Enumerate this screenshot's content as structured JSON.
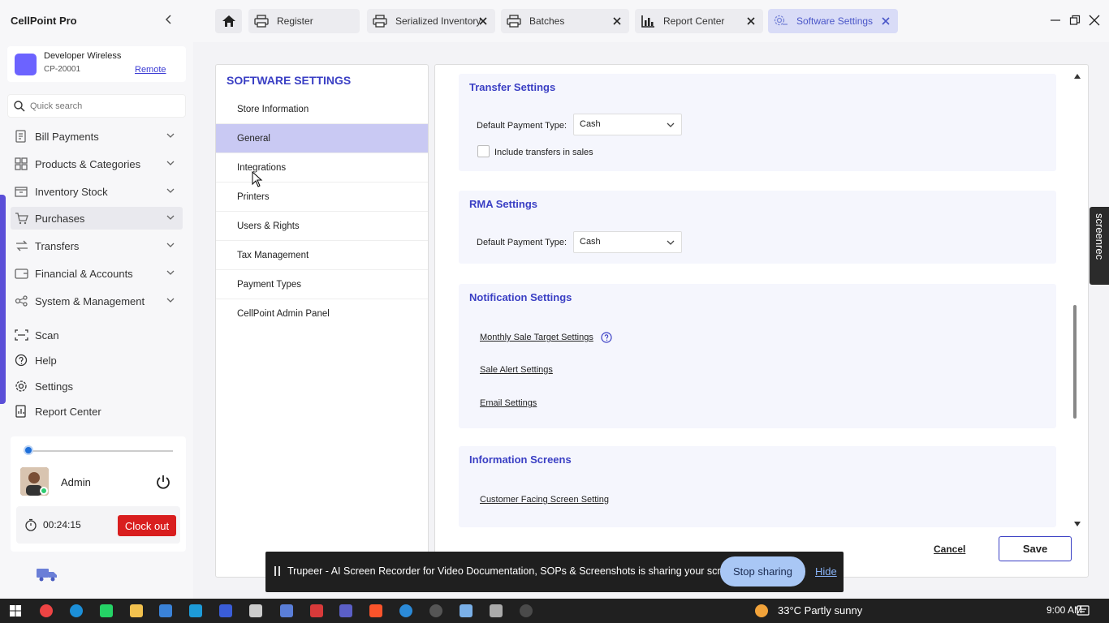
{
  "app": {
    "title": "CellPoint Pro"
  },
  "store": {
    "name": "Developer Wireless",
    "code": "CP-20001",
    "remote_label": "Remote"
  },
  "search": {
    "placeholder": "Quick search"
  },
  "sidebar": {
    "items": [
      {
        "label": "Bill Payments",
        "icon": "receipt-icon",
        "expandable": true
      },
      {
        "label": "Products & Categories",
        "icon": "grid-icon",
        "expandable": true
      },
      {
        "label": "Inventory Stock",
        "icon": "box-icon",
        "expandable": true
      },
      {
        "label": "Purchases",
        "icon": "cart-icon",
        "expandable": true,
        "active": true
      },
      {
        "label": "Transfers",
        "icon": "transfer-icon",
        "expandable": true
      },
      {
        "label": "Financial & Accounts",
        "icon": "wallet-icon",
        "expandable": true
      },
      {
        "label": "System & Management",
        "icon": "system-icon",
        "expandable": true
      },
      {
        "label": "Scan",
        "icon": "scan-icon",
        "expandable": false
      },
      {
        "label": "Help",
        "icon": "help-icon",
        "expandable": false
      },
      {
        "label": "Settings",
        "icon": "gear-icon",
        "expandable": false
      },
      {
        "label": "Report Center",
        "icon": "report-icon",
        "expandable": false
      }
    ]
  },
  "user": {
    "name": "Admin",
    "timer": "00:24:15",
    "clockout_label": "Clock out"
  },
  "tabs": [
    {
      "label": "Register",
      "icon": "printer-icon"
    },
    {
      "label": "Serialized Inventory",
      "icon": "printer-icon"
    },
    {
      "label": "Batches",
      "icon": "printer-icon"
    },
    {
      "label": "Report Center",
      "icon": "chart-icon"
    },
    {
      "label": "Software Settings",
      "icon": "settings-icon",
      "active": true
    }
  ],
  "settings_menu": {
    "title": "SOFTWARE SETTINGS",
    "items": [
      {
        "label": "Store Information"
      },
      {
        "label": "General",
        "active": true
      },
      {
        "label": "Integrations"
      },
      {
        "label": "Printers"
      },
      {
        "label": "Users & Rights"
      },
      {
        "label": "Tax Management"
      },
      {
        "label": "Payment Types"
      },
      {
        "label": "CellPoint Admin Panel"
      }
    ]
  },
  "sections": {
    "transfer": {
      "title": "Transfer Settings",
      "payment_label": "Default Payment Type:",
      "payment_value": "Cash",
      "checkbox_label": "Include transfers in sales",
      "checked": false
    },
    "rma": {
      "title": "RMA Settings",
      "payment_label": "Default Payment Type:",
      "payment_value": "Cash"
    },
    "notification": {
      "title": "Notification Settings",
      "links": [
        "Monthly Sale Target Settings",
        "Sale Alert Settings",
        "Email Settings"
      ]
    },
    "information": {
      "title": "Information Screens",
      "links": [
        "Customer Facing Screen Setting"
      ]
    }
  },
  "actions": {
    "cancel_label": "Cancel",
    "save_label": "Save"
  },
  "screenrec": {
    "label": "screenrec"
  },
  "share_bar": {
    "text": "Trupeer - AI Screen Recorder for Video Documentation, SOPs & Screenshots is sharing your screen.",
    "stop_label": "Stop sharing",
    "hide_label": "Hide"
  },
  "taskbar": {
    "weather": "33°C  Partly sunny",
    "time": "9:00 AM"
  },
  "colors": {
    "accent": "#3a3fc4",
    "active_menu": "#c9c9f3",
    "clockout": "#d91e1e"
  }
}
